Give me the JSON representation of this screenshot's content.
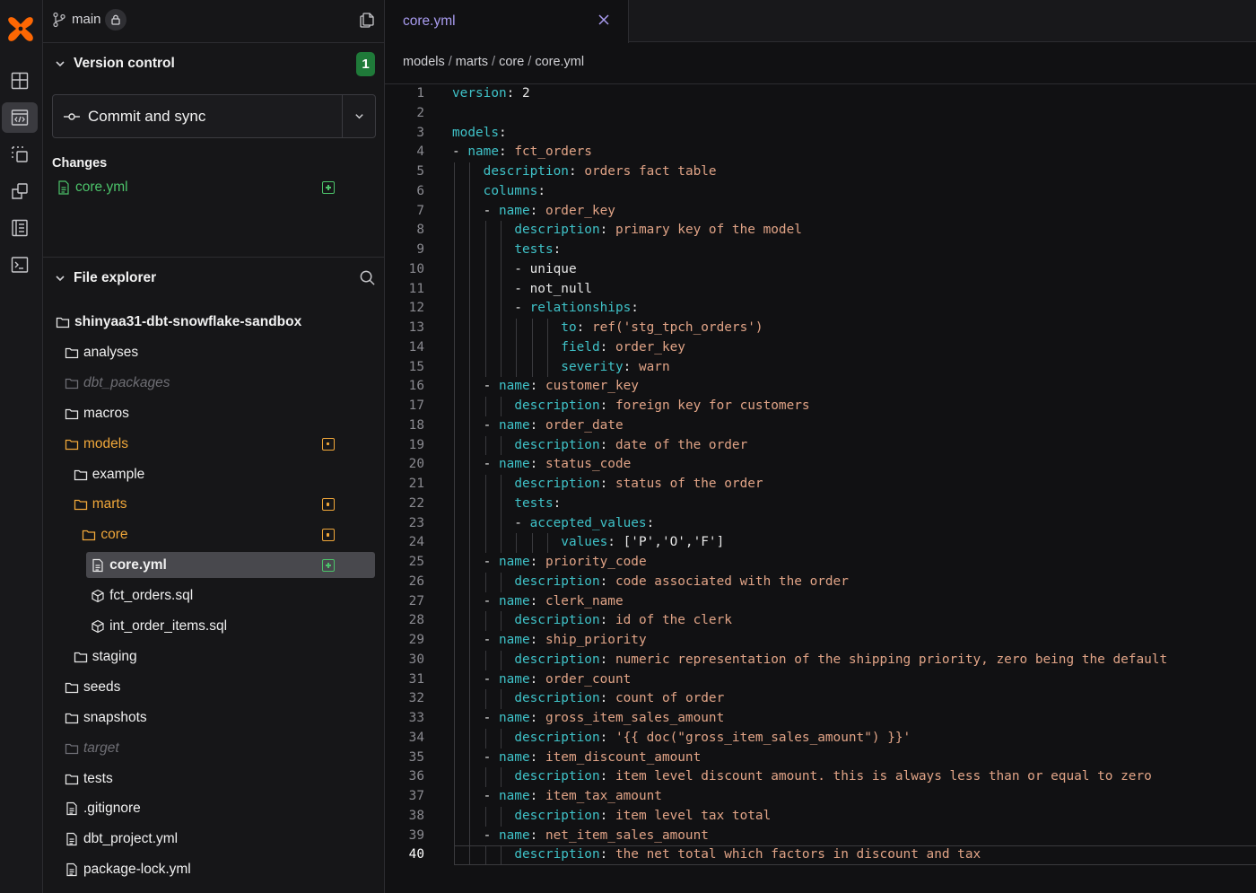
{
  "sidebar": {
    "branch": "main",
    "version_control": {
      "title": "Version control",
      "count": "1",
      "commit_label": "Commit and sync",
      "changes_label": "Changes",
      "changed_files": [
        {
          "name": "core.yml"
        }
      ]
    },
    "file_explorer": {
      "title": "File explorer",
      "items": [
        {
          "name": "shinyaa31-dbt-snowflake-sandbox",
          "type": "folder",
          "depth": 0,
          "style": "root"
        },
        {
          "name": "analyses",
          "type": "folder",
          "depth": 1,
          "style": "normal"
        },
        {
          "name": "dbt_packages",
          "type": "folder",
          "depth": 1,
          "style": "dim"
        },
        {
          "name": "macros",
          "type": "folder",
          "depth": 1,
          "style": "normal"
        },
        {
          "name": "models",
          "type": "folder",
          "depth": 1,
          "style": "mod",
          "badge": "mod"
        },
        {
          "name": "example",
          "type": "folder",
          "depth": 2,
          "style": "normal"
        },
        {
          "name": "marts",
          "type": "folder",
          "depth": 2,
          "style": "mod",
          "badge": "mod"
        },
        {
          "name": "core",
          "type": "folder",
          "depth": 3,
          "style": "mod",
          "badge": "mod"
        },
        {
          "name": "core.yml",
          "type": "file",
          "depth": 4,
          "style": "selected",
          "badge": "add"
        },
        {
          "name": "fct_orders.sql",
          "type": "model",
          "depth": 4,
          "style": "normal"
        },
        {
          "name": "int_order_items.sql",
          "type": "model",
          "depth": 4,
          "style": "normal"
        },
        {
          "name": "staging",
          "type": "folder",
          "depth": 2,
          "style": "normal"
        },
        {
          "name": "seeds",
          "type": "folder",
          "depth": 1,
          "style": "normal"
        },
        {
          "name": "snapshots",
          "type": "folder",
          "depth": 1,
          "style": "normal"
        },
        {
          "name": "target",
          "type": "folder",
          "depth": 1,
          "style": "dim"
        },
        {
          "name": "tests",
          "type": "folder",
          "depth": 1,
          "style": "normal"
        },
        {
          "name": ".gitignore",
          "type": "file",
          "depth": 1,
          "style": "normal"
        },
        {
          "name": "dbt_project.yml",
          "type": "file",
          "depth": 1,
          "style": "normal"
        },
        {
          "name": "package-lock.yml",
          "type": "file",
          "depth": 1,
          "style": "normal"
        }
      ]
    }
  },
  "editor": {
    "tab_label": "core.yml",
    "breadcrumb": [
      "models",
      "marts",
      "core",
      "core.yml"
    ],
    "current_line": 40,
    "lines": [
      {
        "indent": 0,
        "dash": false,
        "key": "version",
        "value": "2"
      },
      {
        "indent": 0,
        "dash": false,
        "key": "",
        "value": ""
      },
      {
        "indent": 0,
        "dash": false,
        "key": "models",
        "value": ""
      },
      {
        "indent": 1,
        "dash": true,
        "key": "name",
        "value": "fct_orders"
      },
      {
        "indent": 2,
        "dash": false,
        "key": "description",
        "value": "orders fact table"
      },
      {
        "indent": 2,
        "dash": false,
        "key": "columns",
        "value": ""
      },
      {
        "indent": 3,
        "dash": true,
        "key": "name",
        "value": "order_key"
      },
      {
        "indent": 4,
        "dash": false,
        "key": "description",
        "value": "primary key of the model"
      },
      {
        "indent": 4,
        "dash": false,
        "key": "tests",
        "value": ""
      },
      {
        "indent": 5,
        "dash": true,
        "key": "",
        "value": "unique"
      },
      {
        "indent": 5,
        "dash": true,
        "key": "",
        "value": "not_null"
      },
      {
        "indent": 5,
        "dash": true,
        "key": "relationships",
        "value": ""
      },
      {
        "indent": 7,
        "dash": false,
        "key": "to",
        "value": "ref('stg_tpch_orders')"
      },
      {
        "indent": 7,
        "dash": false,
        "key": "field",
        "value": "order_key"
      },
      {
        "indent": 7,
        "dash": false,
        "key": "severity",
        "value": "warn"
      },
      {
        "indent": 3,
        "dash": true,
        "key": "name",
        "value": "customer_key"
      },
      {
        "indent": 4,
        "dash": false,
        "key": "description",
        "value": "foreign key for customers"
      },
      {
        "indent": 3,
        "dash": true,
        "key": "name",
        "value": "order_date"
      },
      {
        "indent": 4,
        "dash": false,
        "key": "description",
        "value": "date of the order"
      },
      {
        "indent": 3,
        "dash": true,
        "key": "name",
        "value": "status_code"
      },
      {
        "indent": 4,
        "dash": false,
        "key": "description",
        "value": "status of the order"
      },
      {
        "indent": 4,
        "dash": false,
        "key": "tests",
        "value": ""
      },
      {
        "indent": 5,
        "dash": true,
        "key": "accepted_values",
        "value": ""
      },
      {
        "indent": 7,
        "dash": false,
        "key": "values",
        "value": "['P','O','F']"
      },
      {
        "indent": 3,
        "dash": true,
        "key": "name",
        "value": "priority_code"
      },
      {
        "indent": 4,
        "dash": false,
        "key": "description",
        "value": "code associated with the order"
      },
      {
        "indent": 3,
        "dash": true,
        "key": "name",
        "value": "clerk_name"
      },
      {
        "indent": 4,
        "dash": false,
        "key": "description",
        "value": "id of the clerk"
      },
      {
        "indent": 3,
        "dash": true,
        "key": "name",
        "value": "ship_priority"
      },
      {
        "indent": 4,
        "dash": false,
        "key": "description",
        "value": "numeric representation of the shipping priority, zero being the default"
      },
      {
        "indent": 3,
        "dash": true,
        "key": "name",
        "value": "order_count"
      },
      {
        "indent": 4,
        "dash": false,
        "key": "description",
        "value": "count of order"
      },
      {
        "indent": 3,
        "dash": true,
        "key": "name",
        "value": "gross_item_sales_amount"
      },
      {
        "indent": 4,
        "dash": false,
        "key": "description",
        "value": "'{{ doc(\"gross_item_sales_amount\") }}'"
      },
      {
        "indent": 3,
        "dash": true,
        "key": "name",
        "value": "item_discount_amount"
      },
      {
        "indent": 4,
        "dash": false,
        "key": "description",
        "value": "item level discount amount. this is always less than or equal to zero"
      },
      {
        "indent": 3,
        "dash": true,
        "key": "name",
        "value": "item_tax_amount"
      },
      {
        "indent": 4,
        "dash": false,
        "key": "description",
        "value": "item level tax total"
      },
      {
        "indent": 3,
        "dash": true,
        "key": "name",
        "value": "net_item_sales_amount"
      },
      {
        "indent": 4,
        "dash": false,
        "key": "description",
        "value": "the net total which factors in discount and tax"
      }
    ]
  },
  "icons": {
    "logo": "dbt-logo",
    "rail": [
      "layout-icon",
      "code-editor-icon",
      "select-icon",
      "copy-icon",
      "list-icon",
      "terminal-icon"
    ]
  },
  "colors": {
    "accent_tab": "#a99cf0",
    "yaml_key": "#3fc2c8",
    "yaml_value": "#e0a386",
    "added": "#4cc36a",
    "modified": "#f0a73a"
  }
}
